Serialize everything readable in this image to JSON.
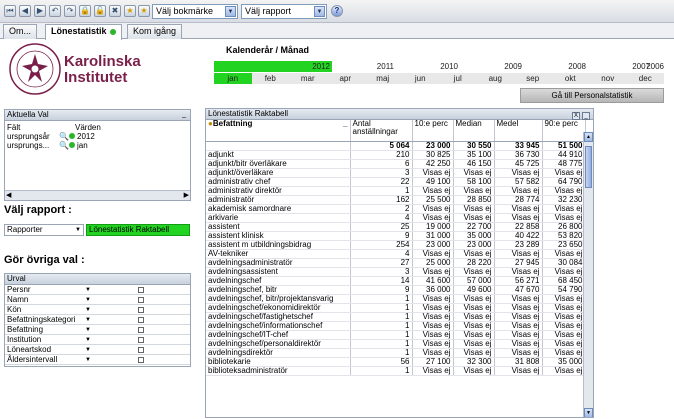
{
  "toolbar": {
    "bookmark_select": "Välj bokmärke",
    "report_select": "Välj rapport"
  },
  "tabs": [
    {
      "label": "Om..."
    },
    {
      "label": "Lönestatistik"
    },
    {
      "label": "Kom igång"
    }
  ],
  "logo": {
    "line1": "Karolinska",
    "line2": "Institutet",
    "seal_text": "KAROLINSKA INSTITUTET"
  },
  "calendar": {
    "title": "Kalenderår / Månad",
    "years": [
      "2012",
      "2011",
      "2010",
      "2009",
      "2008",
      "2007",
      "2006"
    ],
    "selected_year": "2012",
    "months": [
      "jan",
      "feb",
      "mar",
      "apr",
      "maj",
      "jun",
      "jul",
      "aug",
      "sep",
      "okt",
      "nov",
      "dec"
    ],
    "selected_month": "jan"
  },
  "personal_button": "Gå till Personalstatistik",
  "aktuella_val": {
    "title": "Aktuella Val",
    "col_field": "Fält",
    "col_values": "Värden",
    "rows": [
      {
        "field": "ursprungsår",
        "value": "2012"
      },
      {
        "field": "ursprungs...",
        "value": "jan"
      }
    ]
  },
  "valj_rapport": {
    "heading": "Välj rapport :",
    "select_label": "Rapporter",
    "active_report": "Lönestatistik Raktabell"
  },
  "ovriga_val": {
    "heading": "Gör övriga val :",
    "urval_title": "Urval",
    "items": [
      "Persnr",
      "Namn",
      "Kön",
      "Befattningskategori",
      "Befattning",
      "Institution",
      "Löneartskod",
      "Åldersintervall"
    ]
  },
  "table": {
    "title": "Lönestatistik Raktabell",
    "headers": [
      "Befattning",
      "Antal anställningar",
      "10:e perc",
      "Median",
      "Medel",
      "90:e perc"
    ],
    "totals": [
      "5 064",
      "23 000",
      "30 550",
      "33 945",
      "51 500"
    ],
    "rows": [
      [
        "adjunkt",
        "210",
        "30 825",
        "35 100",
        "36 730",
        "44 910"
      ],
      [
        "adjunkt/bitr överläkare",
        "6",
        "42 250",
        "46 150",
        "45 725",
        "48 775"
      ],
      [
        "adjunkt/överläkare",
        "3",
        "Visas ej",
        "Visas ej",
        "Visas ej",
        "Visas ej"
      ],
      [
        "administrativ chef",
        "22",
        "49 100",
        "58 100",
        "57 582",
        "64 790"
      ],
      [
        "administrativ direktör",
        "1",
        "Visas ej",
        "Visas ej",
        "Visas ej",
        "Visas ej"
      ],
      [
        "administratör",
        "162",
        "25 500",
        "28 850",
        "28 774",
        "32 230"
      ],
      [
        "akademisk samordnare",
        "2",
        "Visas ej",
        "Visas ej",
        "Visas ej",
        "Visas ej"
      ],
      [
        "arkivarie",
        "4",
        "Visas ej",
        "Visas ej",
        "Visas ej",
        "Visas ej"
      ],
      [
        "assistent",
        "25",
        "19 000",
        "22 700",
        "22 858",
        "26 800"
      ],
      [
        "assistent klinisk",
        "9",
        "31 000",
        "35 000",
        "40 422",
        "53 820"
      ],
      [
        "assistent m utbildningsbidrag",
        "254",
        "23 000",
        "23 000",
        "23 289",
        "23 650"
      ],
      [
        "AV-tekniker",
        "4",
        "Visas ej",
        "Visas ej",
        "Visas ej",
        "Visas ej"
      ],
      [
        "avdelningsadministratör",
        "27",
        "25 000",
        "28 220",
        "27 945",
        "30 084"
      ],
      [
        "avdelningsassistent",
        "3",
        "Visas ej",
        "Visas ej",
        "Visas ej",
        "Visas ej"
      ],
      [
        "avdelningschef",
        "14",
        "41 600",
        "57 000",
        "56 271",
        "68 450"
      ],
      [
        "avdelningschef, bitr",
        "9",
        "36 000",
        "49 600",
        "47 670",
        "54 790"
      ],
      [
        "avdelningschef, bitr/projektansvarig",
        "1",
        "Visas ej",
        "Visas ej",
        "Visas ej",
        "Visas ej"
      ],
      [
        "avdelningschef/ekonomidirektör",
        "1",
        "Visas ej",
        "Visas ej",
        "Visas ej",
        "Visas ej"
      ],
      [
        "avdelningschef/fastighetschef",
        "1",
        "Visas ej",
        "Visas ej",
        "Visas ej",
        "Visas ej"
      ],
      [
        "avdelningschef/informationschef",
        "1",
        "Visas ej",
        "Visas ej",
        "Visas ej",
        "Visas ej"
      ],
      [
        "avdelningschef/IT-chef",
        "1",
        "Visas ej",
        "Visas ej",
        "Visas ej",
        "Visas ej"
      ],
      [
        "avdelningschef/personaldirektör",
        "1",
        "Visas ej",
        "Visas ej",
        "Visas ej",
        "Visas ej"
      ],
      [
        "avdelningsdirektör",
        "1",
        "Visas ej",
        "Visas ej",
        "Visas ej",
        "Visas ej"
      ],
      [
        "bibliotekarie",
        "56",
        "27 100",
        "32 300",
        "31 808",
        "35 000"
      ],
      [
        "biblioteksadministratör",
        "1",
        "Visas ej",
        "Visas ej",
        "Visas ej",
        "Visas ej"
      ]
    ]
  },
  "colors": {
    "accent_green": "#22d322",
    "brand": "#7a1f4a"
  }
}
